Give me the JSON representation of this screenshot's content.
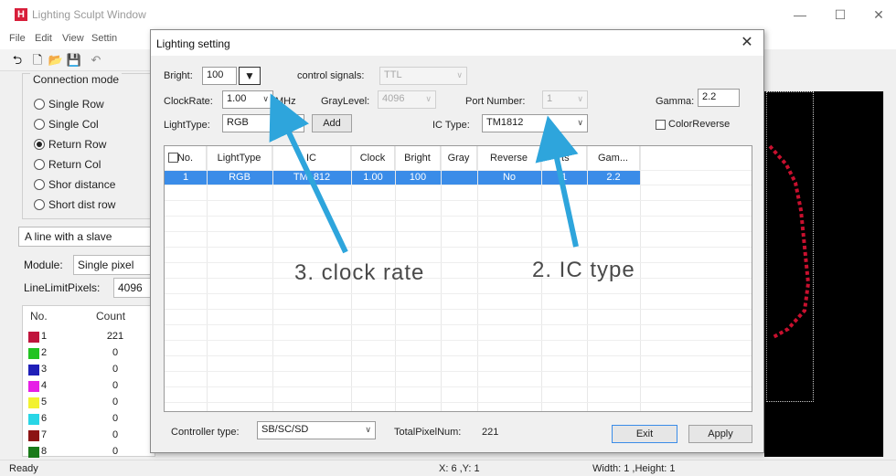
{
  "main_window": {
    "title": "Lighting Sculpt Window",
    "menu": [
      "File",
      "Edit",
      "View",
      "Settin"
    ],
    "controls": [
      "—",
      "☐",
      "✕"
    ]
  },
  "connection_mode": {
    "title": "Connection mode",
    "options": [
      {
        "label": "Single Row",
        "selected": false
      },
      {
        "label": "Single Col",
        "selected": false
      },
      {
        "label": "Return Row",
        "selected": true
      },
      {
        "label": "Return Col",
        "selected": false
      },
      {
        "label": "Shor distance",
        "selected": false
      },
      {
        "label": "Short dist row",
        "selected": false
      }
    ]
  },
  "left": {
    "slave": "A line with a slave",
    "module_label": "Module:",
    "module_value": "Single pixel",
    "line_limit_label": "LineLimitPixels:",
    "line_limit_value": "4096",
    "count_headers": [
      "No.",
      "Count"
    ],
    "count_rows": [
      {
        "no": "1",
        "count": "221",
        "color": "#c0143c"
      },
      {
        "no": "2",
        "count": "0",
        "color": "#22c322"
      },
      {
        "no": "3",
        "count": "0",
        "color": "#1f1fb8"
      },
      {
        "no": "4",
        "count": "0",
        "color": "#e61ee6"
      },
      {
        "no": "5",
        "count": "0",
        "color": "#f2f230"
      },
      {
        "no": "6",
        "count": "0",
        "color": "#28d6e6"
      },
      {
        "no": "7",
        "count": "0",
        "color": "#8c1414"
      },
      {
        "no": "8",
        "count": "0",
        "color": "#1a7a1a"
      }
    ]
  },
  "status": {
    "ready": "Ready",
    "coords": "X: 6 ,Y: 1",
    "size": "Width: 1 ,Height: 1"
  },
  "dialog": {
    "title": "Lighting setting",
    "bright_label": "Bright:",
    "bright_value": "100",
    "control_signals_label": "control signals:",
    "control_signals_value": "TTL",
    "clockrate_label": "ClockRate:",
    "clockrate_value": "1.00",
    "clockrate_unit": "MHz",
    "graylevel_label": "GrayLevel:",
    "graylevel_value": "4096",
    "port_label": "Port Number:",
    "port_value": "1",
    "gamma_label": "Gamma:",
    "gamma_value": "2.2",
    "lighttype_label": "LightType:",
    "lighttype_value": "RGB",
    "add_label": "Add",
    "ictype_label": "IC Type:",
    "ictype_value": "TM1812",
    "colorreverse_label": "ColorReverse",
    "table_headers": [
      "No.",
      "LightType",
      "IC",
      "Clock",
      "Bright",
      "Gray",
      "Reverse",
      "rts",
      "Gam..."
    ],
    "table_row": [
      "1",
      "RGB",
      "TM1812",
      "1.00",
      "100",
      "",
      "No",
      "1",
      "2.2"
    ],
    "controller_label": "Controller type:",
    "controller_value": "SB/SC/SD",
    "totalpixel_label": "TotalPixelNum:",
    "totalpixel_value": "221",
    "exit_label": "Exit",
    "apply_label": "Apply"
  },
  "annotations": {
    "clock": "3. clock rate",
    "ic": "2. IC type"
  },
  "colors": {
    "accent_arrow": "#2ea5dc",
    "selection": "#3a8ce8"
  }
}
